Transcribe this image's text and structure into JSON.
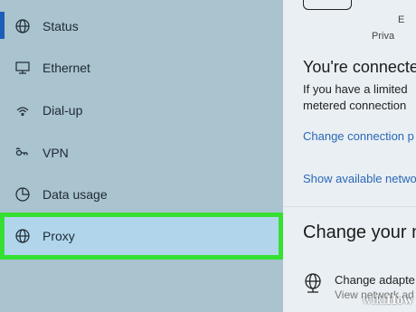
{
  "sidebar": {
    "items": [
      {
        "label": "Status",
        "icon": "globe-icon"
      },
      {
        "label": "Ethernet",
        "icon": "monitor-icon"
      },
      {
        "label": "Dial-up",
        "icon": "dialup-icon"
      },
      {
        "label": "VPN",
        "icon": "vpn-icon"
      },
      {
        "label": "Data usage",
        "icon": "pie-chart-icon"
      },
      {
        "label": "Proxy",
        "icon": "globe-icon"
      }
    ],
    "highlight_color": "#36e032",
    "active_indicator_color": "#1d5fb8"
  },
  "main": {
    "corner_line1": "E",
    "corner_line2": "Priva",
    "heading": "You're connecte",
    "desc_line1": "If you have a limited",
    "desc_line2": "metered connection",
    "link_change_props": "Change connection p",
    "link_show_networks": "Show available netwo",
    "section_heading": "Change your n",
    "adapter_title": "Change adapte",
    "adapter_sub": "View network ad",
    "link_color": "#2b67b5"
  },
  "watermark": {
    "wiki": "wiki",
    "how": "How"
  }
}
